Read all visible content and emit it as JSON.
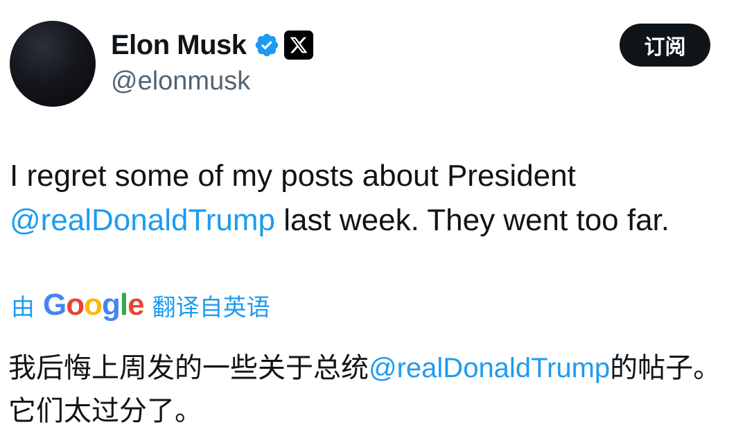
{
  "author": {
    "display_name": "Elon Musk",
    "handle": "@elonmusk",
    "verified_badge_icon": "verified-check-icon",
    "affiliate_badge_icon": "x-logo-icon",
    "colors": {
      "verified": "#1d9bf0"
    }
  },
  "actions": {
    "subscribe_label": "订阅"
  },
  "tweet": {
    "text_part1": "I regret some of my posts about President ",
    "mention": "@realDonaldTrump",
    "text_part2": " last week. They went too far."
  },
  "translation": {
    "prefix": "由",
    "provider": "Google",
    "suffix": "翻译自英语",
    "text_part1": "我后悔上周发的一些关于总统",
    "mention": "@realDonaldTrump",
    "text_part2": "的帖子。它们太过分了。"
  },
  "colors": {
    "link": "#1d9bf0",
    "text": "#0f1419",
    "secondary": "#536471",
    "button_bg": "#0f1419"
  }
}
